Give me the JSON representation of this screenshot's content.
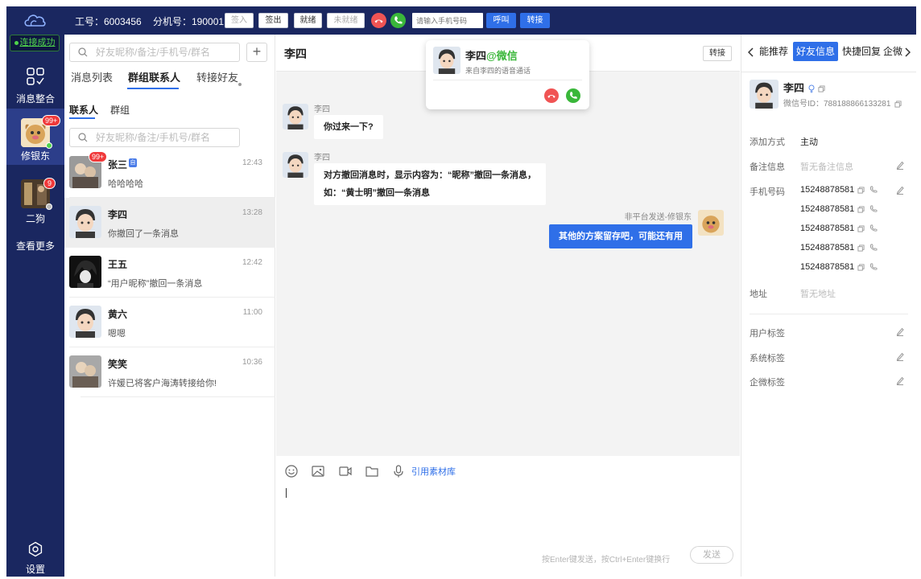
{
  "topbar": {
    "agent_id": "工号：6003456",
    "ext": "分机号：190001",
    "btn_signin": "签入",
    "btn_signout": "签出",
    "btn_ready": "就绪",
    "btn_notready": "未就绪",
    "phone_placeholder": "请输入手机号码",
    "btn_call": "呼叫",
    "btn_transfer": "转接"
  },
  "nav": {
    "connection": "连接成功",
    "items": [
      {
        "label": "消息整合"
      },
      {
        "label": "修银东",
        "badge": "99+"
      },
      {
        "label": "二狗",
        "badge": "9"
      }
    ],
    "more": "查看更多",
    "settings": "设置"
  },
  "contacts": {
    "search_placeholder": "好友昵称/备注/手机号/群名",
    "tabs": [
      "消息列表",
      "群组联系人",
      "转接好友"
    ],
    "subtabs": [
      "联系人",
      "群组"
    ],
    "sub_search_placeholder": "好友昵称/备注/手机号/群名",
    "list": [
      {
        "name": "张三",
        "time": "12:43",
        "msg": "哈哈哈哈",
        "badge": "99+",
        "tag": "自"
      },
      {
        "name": "李四",
        "time": "13:28",
        "msg": "你撤回了一条消息"
      },
      {
        "name": "王五",
        "time": "12:42",
        "msg": "“用户昵称”撤回一条消息"
      },
      {
        "name": "黄六",
        "time": "11:00",
        "msg": "嗯嗯"
      },
      {
        "name": "笑笑",
        "time": "10:36",
        "msg": "许媛已将客户海涛转接给你!"
      }
    ]
  },
  "chat": {
    "title": "李四",
    "transfer": "转接",
    "messages": [
      {
        "sender": "李四",
        "text": "你过来一下?"
      },
      {
        "sender": "李四",
        "line1": "对方撤回消息时，显示内容为：“昵称”撤回一条消息，",
        "line2": "如：“黄士明”撤回一条消息"
      },
      {
        "sender": "非平台发送-修银东",
        "text": "其他的方案留存吧，可能还有用"
      }
    ],
    "quote_library": "引用素材库",
    "hint": "按Enter键发送，按Ctrl+Enter键换行",
    "send": "发送"
  },
  "call_popup": {
    "name": "李四",
    "channel": "@微信",
    "subtitle": "来自李四的语音通话"
  },
  "right": {
    "tabs": [
      "能推荐",
      "好友信息",
      "快捷回复",
      "企微"
    ],
    "name": "李四",
    "wxid": "微信号ID：788188866133281",
    "fields": {
      "add_method_label": "添加方式",
      "add_method": "主动",
      "remark_label": "备注信息",
      "remark": "暂无备注信息",
      "phone_label": "手机号码",
      "phones": [
        "15248878581",
        "15248878581",
        "15248878581",
        "15248878581",
        "15248878581"
      ],
      "address_label": "地址",
      "address": "暂无地址",
      "user_tag": "用户标签",
      "sys_tag": "系统标签",
      "wecom_tag": "企微标签"
    }
  },
  "colors": {
    "nav_bg": "#1a2760",
    "accent": "#2f6fe8",
    "hangup": "#f05454",
    "answer": "#3ab73a"
  }
}
